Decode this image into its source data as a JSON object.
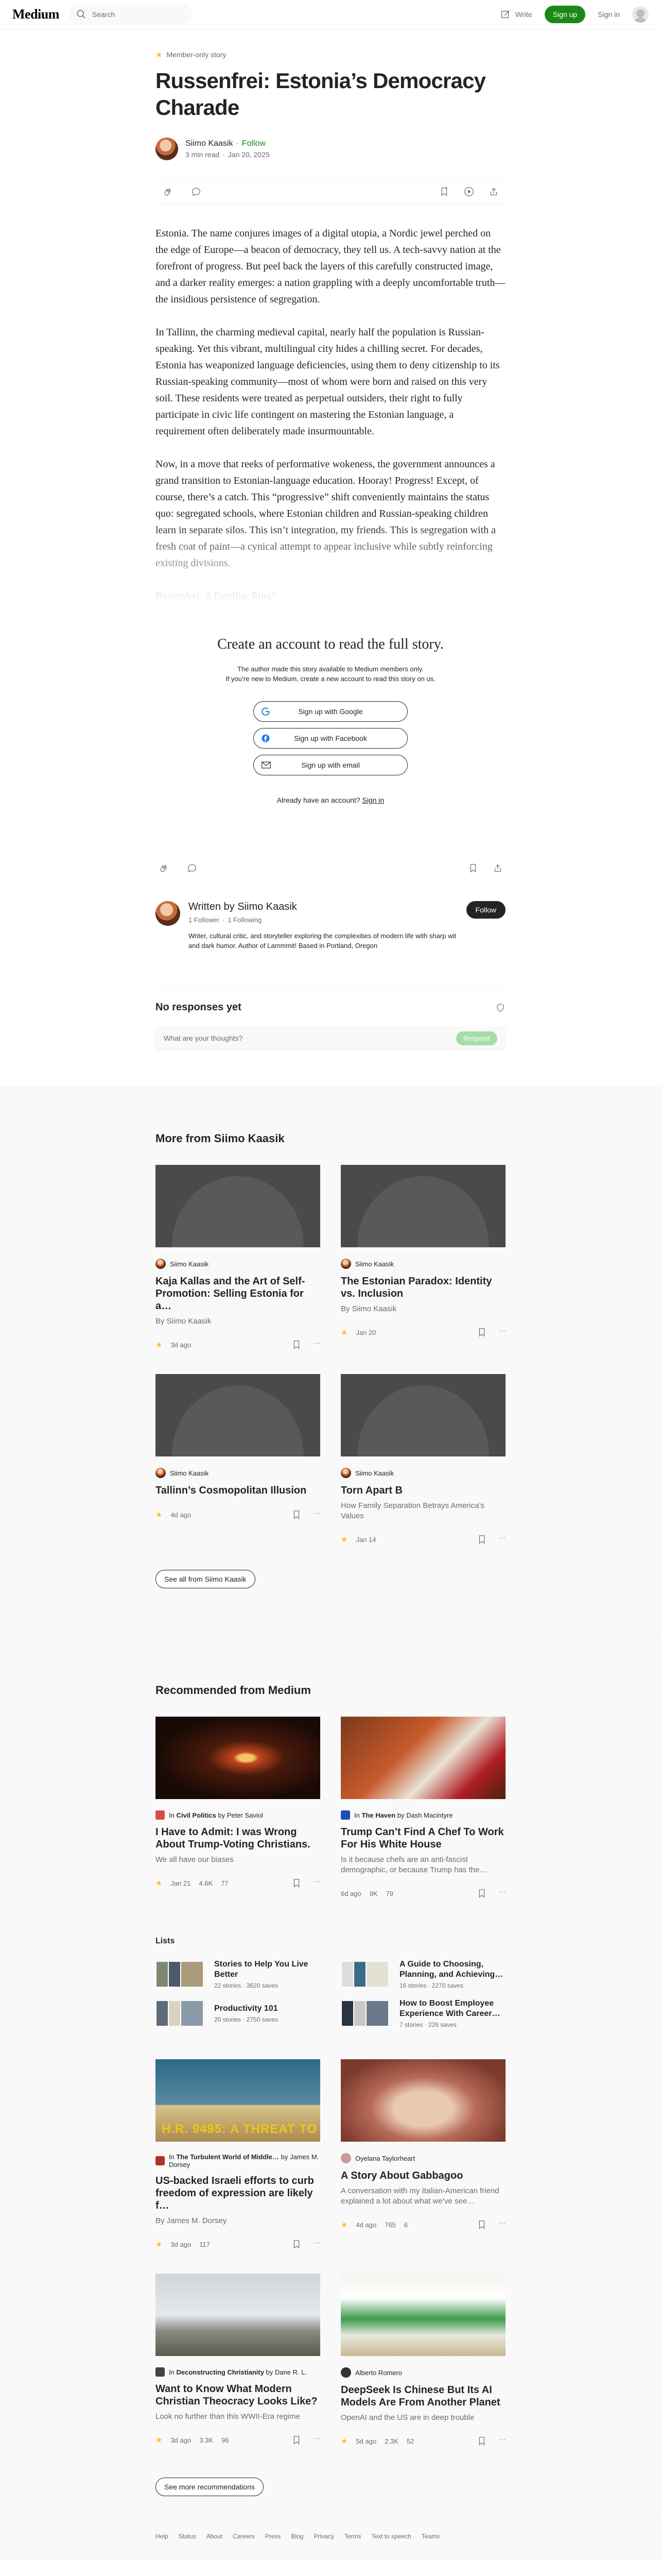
{
  "header": {
    "logo": "Medium",
    "search_placeholder": "Search",
    "write": "Write",
    "sign_up": "Sign up",
    "sign_in": "Sign in"
  },
  "article": {
    "member_only": "Member-only story",
    "title": "Russenfrei: Estonia’s Democracy Charade",
    "author": "Siimo Kaasik",
    "follow": "Follow",
    "read_time": "3 min read",
    "date": "Jan 20, 2025",
    "paragraphs": [
      "Estonia. The name conjures images of a digital utopia, a Nordic jewel perched on the edge of Europe—a beacon of democracy, they tell us. A tech-savvy nation at the forefront of progress. But peel back the layers of this carefully constructed image, and a darker reality emerges: a nation grappling with a deeply uncomfortable truth—the insidious persistence of segregation.",
      "In Tallinn, the charming medieval capital, nearly half the population is Russian-speaking. Yet this vibrant, multilingual city hides a chilling secret. For decades, Estonia has weaponized language deficiencies, using them to deny citizenship to its Russian-speaking community—most of whom were born and raised on this very soil. These residents were treated as perpetual outsiders, their right to fully participate in civic life contingent on mastering the Estonian language, a requirement often deliberately made insurmountable.",
      "Now, in a move that reeks of performative wokeness, the government announces a grand transition to Estonian-language education. Hooray! Progress! Except, of course, there’s a catch. This “progressive” shift conveniently maintains the status quo: segregated schools, where Estonian children and Russian-speaking children learn in separate silos. This isn’t integration, my friends. This is segregation with a fresh coat of paint—a cynical attempt to appear inclusive while subtly reinforcing existing divisions.",
      "Russenfrei: A Familiar Ring?"
    ]
  },
  "paywall": {
    "heading": "Create an account to read the full story.",
    "note1": "The author made this story available to Medium members only.",
    "note2": "If you’re new to Medium, create a new account to read this story on us.",
    "google": "Sign up with Google",
    "facebook": "Sign up with Facebook",
    "email": "Sign up with email",
    "have_account": "Already have an account?",
    "sign_in": "Sign in"
  },
  "author_box": {
    "written_by": "Written by Siimo Kaasik",
    "followers": "1 Follower",
    "following": "1 Following",
    "bio": "Writer, cultural critic, and storyteller exploring the complexities of modern life with sharp wit and dark humor. Author of Lammmit! Based in Portland, Oregon",
    "follow": "Follow"
  },
  "responses": {
    "heading": "No responses yet",
    "placeholder": "What are your thoughts?",
    "respond": "Respond"
  },
  "more_from": {
    "heading": "More from Siimo Kaasik",
    "cards": [
      {
        "author": "Siimo Kaasik",
        "title": "Kaja Kallas and the Art of Self-Promotion: Selling Estonia for a…",
        "sub": "By Siimo Kaasik",
        "date": "3d ago"
      },
      {
        "author": "Siimo Kaasik",
        "title": "The Estonian Paradox: Identity vs. Inclusion",
        "sub": "By Siimo Kaasik",
        "date": "Jan 20"
      },
      {
        "author": "Siimo Kaasik",
        "title": "Tallinn’s Cosmopolitan Illusion",
        "sub": "",
        "date": "4d ago"
      },
      {
        "author": "Siimo Kaasik",
        "title": "Torn Apart B",
        "sub": "How Family Separation Betrays America’s Values",
        "date": "Jan 14"
      }
    ],
    "see_all": "See all from Siimo Kaasik"
  },
  "recommended": {
    "heading": "Recommended from Medium",
    "cards_top": [
      {
        "pub": "Civil Politics",
        "author": "Peter Saviol",
        "title": "I Have to Admit: I was Wrong About Trump-Voting Christians.",
        "sub": "We all have our biases",
        "date": "Jan 21",
        "claps": "4.6K",
        "comments": "77"
      },
      {
        "pub": "The Haven",
        "author": "Dash Macintyre",
        "title": "Trump Can’t Find A Chef To Work For His White House",
        "sub": "Is it because chefs are an anti-fascist demographic, or because Trump has the…",
        "date": "6d ago",
        "claps": "9K",
        "comments": "79"
      }
    ],
    "lists_heading": "Lists",
    "lists": [
      {
        "title": "Stories to Help You Live Better",
        "meta": "22 stories · 3620 saves"
      },
      {
        "title": "A Guide to Choosing, Planning, and Achieving…",
        "meta": "16 stories · 2270 saves"
      },
      {
        "title": "Productivity 101",
        "meta": "20 stories · 2750 saves"
      },
      {
        "title": "How to Boost Employee Experience With Career…",
        "meta": "7 stories · 226 saves"
      }
    ],
    "cards_bottom": [
      {
        "pub": "The Turbulent World of Middle…",
        "author": "James M. Dorsey",
        "title": "US-backed Israeli efforts to curb freedom of expression are likely f…",
        "sub": "By James M. Dorsey",
        "date": "3d ago",
        "claps": "117",
        "comments": ""
      },
      {
        "pub": "",
        "author": "Oyelana Taylorheart",
        "title": "A Story About Gabbagoo",
        "sub": "A conversation with my Italian-American friend explained a lot about what we’ve see…",
        "date": "4d ago",
        "claps": "765",
        "comments": "6"
      },
      {
        "pub": "Deconstructing Christianity",
        "author": "Dane R. L.",
        "title": "Want to Know What Modern Christian Theocracy Looks Like?",
        "sub": "Look no further than this WWII-Era regime",
        "date": "3d ago",
        "claps": "3.3K",
        "comments": "96"
      },
      {
        "pub": "",
        "author": "Alberto Romero",
        "title": "DeepSeek Is Chinese But Its AI Models Are From Another Planet",
        "sub": "OpenAI and the US are in deep trouble",
        "date": "5d ago",
        "claps": "2.3K",
        "comments": "52"
      }
    ],
    "see_more": "See more recommendations",
    "banner_text": "H.R. 9495: A THREAT TO"
  },
  "footer": [
    "Help",
    "Status",
    "About",
    "Careers",
    "Press",
    "Blog",
    "Privacy",
    "Terms",
    "Text to speech",
    "Teams"
  ]
}
